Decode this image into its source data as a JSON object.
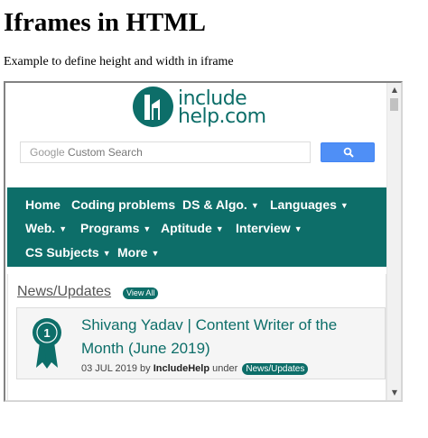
{
  "page": {
    "title": "Iframes in HTML",
    "description": "Example to define height and width in iframe"
  },
  "iframe": {
    "logo": {
      "icon": "includehelp-logo-icon",
      "line1": "include",
      "line2": "help.com",
      "color": "#0d6e69"
    },
    "search": {
      "brand": "Google",
      "placeholder": "Custom Search",
      "button_icon": "search-icon",
      "button_color": "#4f8ff6"
    },
    "nav": {
      "items": [
        {
          "label": "Home",
          "dropdown": false
        },
        {
          "label": "Coding problems",
          "dropdown": false
        },
        {
          "label": "DS & Algo.",
          "dropdown": true
        },
        {
          "label": "Languages",
          "dropdown": true
        },
        {
          "label": "Web.",
          "dropdown": true
        },
        {
          "label": "Programs",
          "dropdown": true
        },
        {
          "label": "Aptitude",
          "dropdown": true
        },
        {
          "label": "Interview",
          "dropdown": true
        },
        {
          "label": "CS Subjects",
          "dropdown": true
        },
        {
          "label": "More",
          "dropdown": true
        }
      ],
      "caret": "▼"
    },
    "news": {
      "heading": "News/Updates",
      "view_all": "View All",
      "card": {
        "icon": "award-ribbon-icon",
        "title": "Shivang Yadav | Content Writer of the Month (June 2019)",
        "date": "03 JUL 2019",
        "by": "by",
        "author": "IncludeHelp",
        "under": "under",
        "tag": "News/Updates"
      }
    },
    "scrollbar": {
      "up": "▲",
      "down": "▼"
    }
  }
}
